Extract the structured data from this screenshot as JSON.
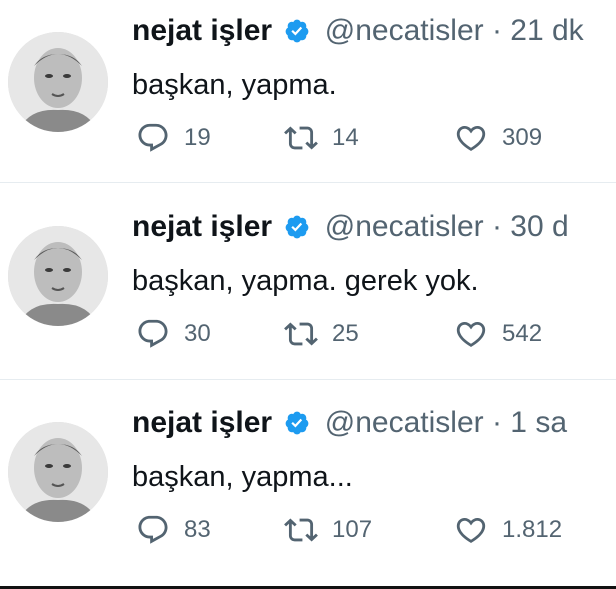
{
  "tweets": [
    {
      "name": "nejat işler",
      "handle": "@necatisler",
      "time": "21 dk",
      "text": "başkan, yapma.",
      "replies": "19",
      "retweets": "14",
      "likes": "309"
    },
    {
      "name": "nejat işler",
      "handle": "@necatisler",
      "time": "30 d",
      "text": "başkan, yapma. gerek yok.",
      "replies": "30",
      "retweets": "25",
      "likes": "542"
    },
    {
      "name": "nejat işler",
      "handle": "@necatisler",
      "time": "1 sa",
      "text": "başkan, yapma...",
      "replies": "83",
      "retweets": "107",
      "likes": "1.812"
    }
  ],
  "separator": " · ",
  "colors": {
    "verified": "#1d9bf0",
    "muted": "#536471",
    "text": "#0f1419"
  },
  "icons": {
    "reply": "reply-icon",
    "retweet": "retweet-icon",
    "like": "like-icon",
    "verified": "verified-badge-icon"
  }
}
